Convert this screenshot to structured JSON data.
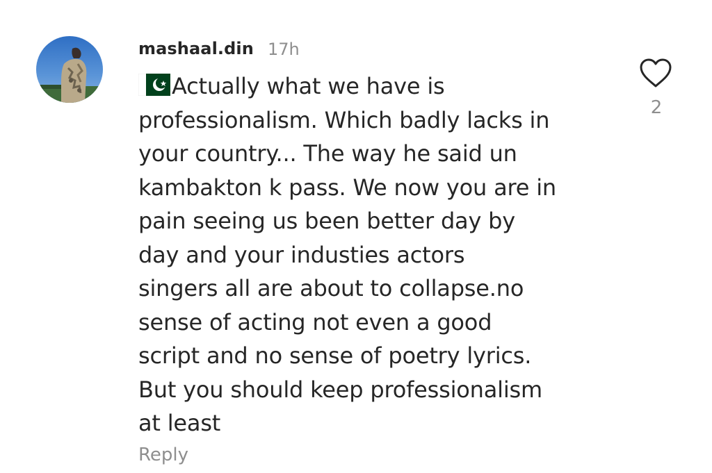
{
  "comment": {
    "username": "mashaal.din",
    "timestamp": "17h",
    "flag_emoji": "🇵🇰",
    "lines": [
      "Actually what we have is",
      "professionalism. Which badly lacks in",
      "your country... The way he said un",
      "kambakton k pass. We now you are in",
      "pain seeing us been better day by",
      "day and your industies actors",
      "singers all are about to collapse.no",
      "sense of acting not even a good",
      "script and no sense of poetry lyrics.",
      "But you should keep professionalism",
      "at least"
    ],
    "reply_label": "Reply",
    "like_count": "2"
  },
  "icons": {
    "like": "heart-outline-icon",
    "flag": "pakistan-flag-icon"
  },
  "colors": {
    "text": "#262626",
    "muted": "#8e8e8e",
    "flag_green": "#01411c"
  }
}
